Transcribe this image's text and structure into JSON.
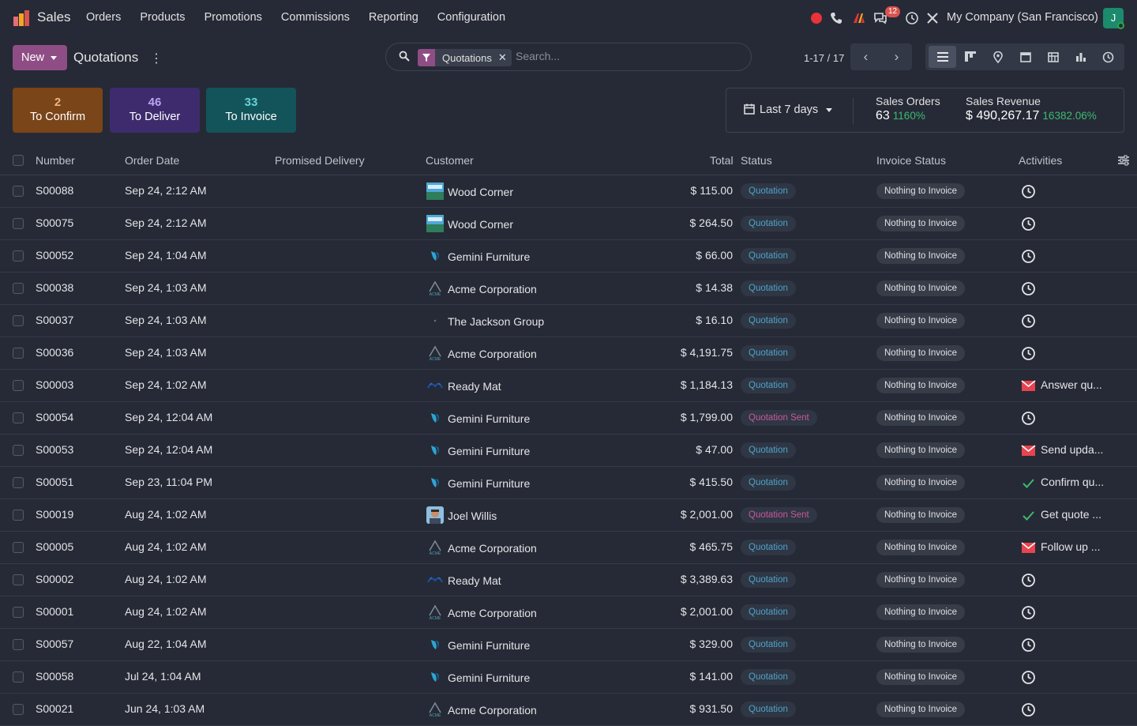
{
  "topbar": {
    "app_name": "Sales",
    "menu": [
      "Orders",
      "Products",
      "Promotions",
      "Commissions",
      "Reporting",
      "Configuration"
    ],
    "messages_count": "12",
    "company": "My Company (San Francisco)",
    "avatar_letter": "J"
  },
  "control": {
    "new_label": "New",
    "title": "Quotations",
    "facet_label": "Quotations",
    "search_placeholder": "Search...",
    "pager": "1-17 / 17"
  },
  "cards": [
    {
      "num": "2",
      "label": "To Confirm",
      "bg": "#7A4518",
      "num_color": "#F3B17C"
    },
    {
      "num": "46",
      "label": "To Deliver",
      "bg": "#3E2B6E",
      "num_color": "#B6A6F0"
    },
    {
      "num": "33",
      "label": "To Invoice",
      "bg": "#13545A",
      "num_color": "#66D2D8"
    }
  ],
  "stats": {
    "period": "Last 7 days",
    "orders_label": "Sales Orders",
    "orders_value": "63",
    "orders_pct": "1160%",
    "revenue_label": "Sales Revenue",
    "revenue_value": "$ 490,267.17",
    "revenue_pct": "16382.06%"
  },
  "columns": {
    "number": "Number",
    "order_date": "Order Date",
    "promised": "Promised Delivery",
    "customer": "Customer",
    "total": "Total",
    "status": "Status",
    "invoice_status": "Invoice Status",
    "activities": "Activities"
  },
  "rows": [
    {
      "number": "S00088",
      "date": "Sep 24, 2:12 AM",
      "customer": "Wood Corner",
      "logo": "wood",
      "total": "$ 115.00",
      "status": "Quotation",
      "invoice": "Nothing to Invoice",
      "activity": "clock",
      "activity_text": ""
    },
    {
      "number": "S00075",
      "date": "Sep 24, 2:12 AM",
      "customer": "Wood Corner",
      "logo": "wood",
      "total": "$ 264.50",
      "status": "Quotation",
      "invoice": "Nothing to Invoice",
      "activity": "clock",
      "activity_text": ""
    },
    {
      "number": "S00052",
      "date": "Sep 24, 1:04 AM",
      "customer": "Gemini Furniture",
      "logo": "gemini",
      "total": "$ 66.00",
      "status": "Quotation",
      "invoice": "Nothing to Invoice",
      "activity": "clock",
      "activity_text": ""
    },
    {
      "number": "S00038",
      "date": "Sep 24, 1:03 AM",
      "customer": "Acme Corporation",
      "logo": "acme",
      "total": "$ 14.38",
      "status": "Quotation",
      "invoice": "Nothing to Invoice",
      "activity": "clock",
      "activity_text": ""
    },
    {
      "number": "S00037",
      "date": "Sep 24, 1:03 AM",
      "customer": "The Jackson Group",
      "logo": "jackson",
      "total": "$ 16.10",
      "status": "Quotation",
      "invoice": "Nothing to Invoice",
      "activity": "clock",
      "activity_text": ""
    },
    {
      "number": "S00036",
      "date": "Sep 24, 1:03 AM",
      "customer": "Acme Corporation",
      "logo": "acme",
      "total": "$ 4,191.75",
      "status": "Quotation",
      "invoice": "Nothing to Invoice",
      "activity": "clock",
      "activity_text": ""
    },
    {
      "number": "S00003",
      "date": "Sep 24, 1:02 AM",
      "customer": "Ready Mat",
      "logo": "ready",
      "total": "$ 1,184.13",
      "status": "Quotation",
      "invoice": "Nothing to Invoice",
      "activity": "email",
      "activity_text": "Answer qu..."
    },
    {
      "number": "S00054",
      "date": "Sep 24, 12:04 AM",
      "customer": "Gemini Furniture",
      "logo": "gemini",
      "total": "$ 1,799.00",
      "status": "Quotation Sent",
      "invoice": "Nothing to Invoice",
      "activity": "clock",
      "activity_text": ""
    },
    {
      "number": "S00053",
      "date": "Sep 24, 12:04 AM",
      "customer": "Gemini Furniture",
      "logo": "gemini",
      "total": "$ 47.00",
      "status": "Quotation",
      "invoice": "Nothing to Invoice",
      "activity": "email",
      "activity_text": "Send upda..."
    },
    {
      "number": "S00051",
      "date": "Sep 23, 11:04 PM",
      "customer": "Gemini Furniture",
      "logo": "gemini",
      "total": "$ 415.50",
      "status": "Quotation",
      "invoice": "Nothing to Invoice",
      "activity": "check",
      "activity_text": "Confirm qu..."
    },
    {
      "number": "S00019",
      "date": "Aug 24, 1:02 AM",
      "customer": "Joel Willis",
      "logo": "person",
      "total": "$ 2,001.00",
      "status": "Quotation Sent",
      "invoice": "Nothing to Invoice",
      "activity": "check",
      "activity_text": "Get quote ..."
    },
    {
      "number": "S00005",
      "date": "Aug 24, 1:02 AM",
      "customer": "Acme Corporation",
      "logo": "acme",
      "total": "$ 465.75",
      "status": "Quotation",
      "invoice": "Nothing to Invoice",
      "activity": "email",
      "activity_text": "Follow up ..."
    },
    {
      "number": "S00002",
      "date": "Aug 24, 1:02 AM",
      "customer": "Ready Mat",
      "logo": "ready",
      "total": "$ 3,389.63",
      "status": "Quotation",
      "invoice": "Nothing to Invoice",
      "activity": "clock",
      "activity_text": ""
    },
    {
      "number": "S00001",
      "date": "Aug 24, 1:02 AM",
      "customer": "Acme Corporation",
      "logo": "acme",
      "total": "$ 2,001.00",
      "status": "Quotation",
      "invoice": "Nothing to Invoice",
      "activity": "clock",
      "activity_text": ""
    },
    {
      "number": "S00057",
      "date": "Aug 22, 1:04 AM",
      "customer": "Gemini Furniture",
      "logo": "gemini",
      "total": "$ 329.00",
      "status": "Quotation",
      "invoice": "Nothing to Invoice",
      "activity": "clock",
      "activity_text": ""
    },
    {
      "number": "S00058",
      "date": "Jul 24, 1:04 AM",
      "customer": "Gemini Furniture",
      "logo": "gemini",
      "total": "$ 141.00",
      "status": "Quotation",
      "invoice": "Nothing to Invoice",
      "activity": "clock",
      "activity_text": ""
    },
    {
      "number": "S00021",
      "date": "Jun 24, 1:03 AM",
      "customer": "Acme Corporation",
      "logo": "acme",
      "total": "$ 931.50",
      "status": "Quotation",
      "invoice": "Nothing to Invoice",
      "activity": "clock",
      "activity_text": ""
    }
  ]
}
